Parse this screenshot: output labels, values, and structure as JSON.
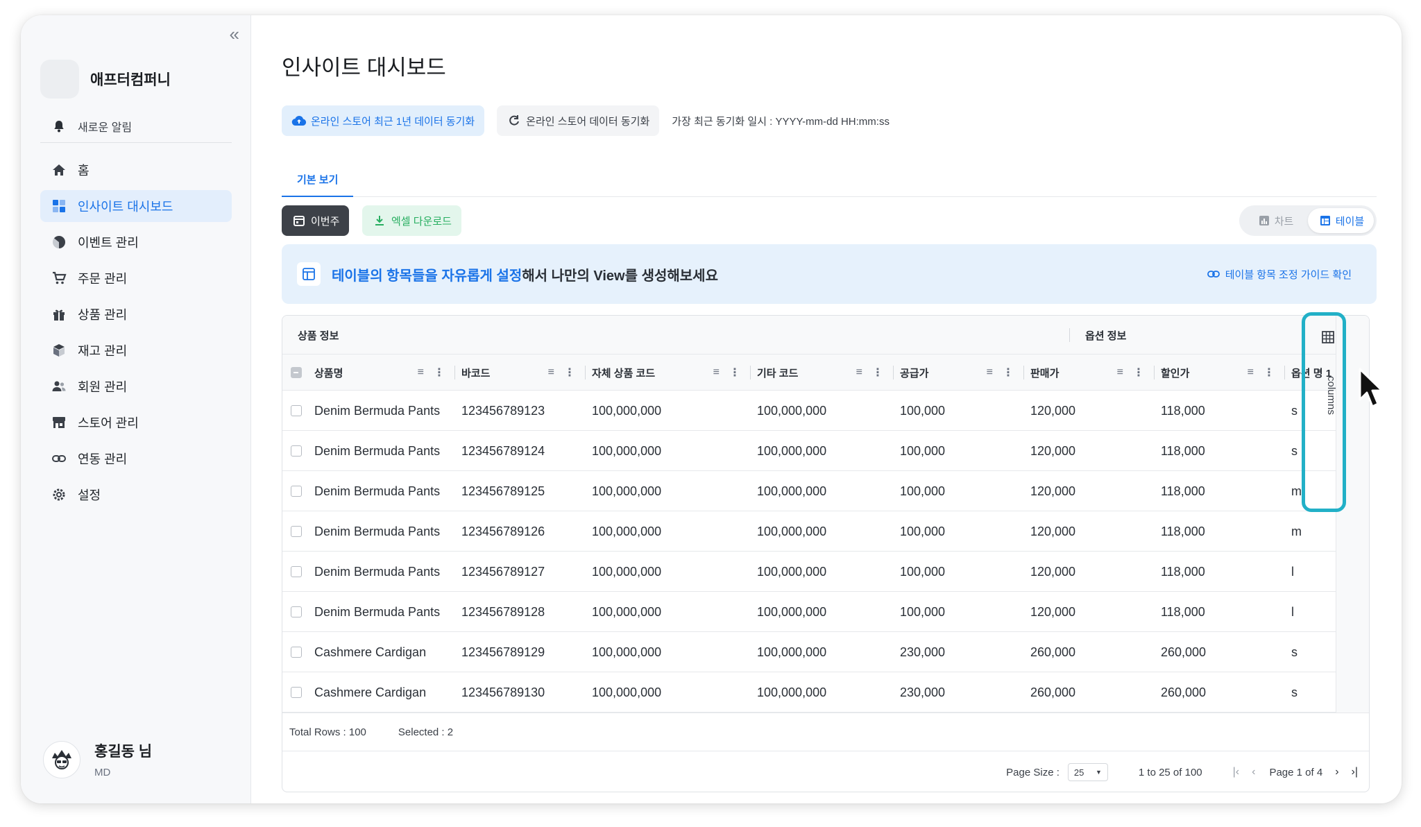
{
  "sidebar": {
    "company": "애프터컴퍼니",
    "notification": "새로운 알림",
    "items": [
      {
        "label": "홈",
        "icon": "home-icon"
      },
      {
        "label": "인사이트 대시보드",
        "icon": "dashboard-icon",
        "active": true
      },
      {
        "label": "이벤트 관리",
        "icon": "pie-chart-icon"
      },
      {
        "label": "주문 관리",
        "icon": "cart-icon"
      },
      {
        "label": "상품 관리",
        "icon": "gift-icon"
      },
      {
        "label": "재고 관리",
        "icon": "box-icon"
      },
      {
        "label": "회원 관리",
        "icon": "users-icon"
      },
      {
        "label": "스토어 관리",
        "icon": "store-icon"
      },
      {
        "label": "연동 관리",
        "icon": "link-icon"
      },
      {
        "label": "설정",
        "icon": "gear-icon"
      }
    ],
    "user": {
      "name": "홍길동 님",
      "role": "MD"
    }
  },
  "main": {
    "title": "인사이트 대시보드",
    "sync_1y": "온라인 스토어 최근 1년 데이터 동기화",
    "sync": "온라인 스토어 데이터 동기화",
    "last_sync": "가장 최근 동기화 일시 : YYYY-mm-dd HH:mm:ss",
    "tab": "기본 보기",
    "week_btn": "이번주",
    "excel_btn": "엑셀 다운로드",
    "toggle_chart": "차트",
    "toggle_table": "테이블",
    "banner_highlight": "테이블의 항목들을 자유롭게 설정",
    "banner_rest": "해서 나만의 View를 생성해보세요",
    "banner_link": "테이블 항목 조정 가이드 확인"
  },
  "grid": {
    "group_1": "상품 정보",
    "group_2": "옵션 정보",
    "columns": [
      "상품명",
      "바코드",
      "자체 상품 코드",
      "기타 코드",
      "공급가",
      "판매가",
      "할인가",
      "옵션 명 1"
    ],
    "rows": [
      [
        "Denim Bermuda Pants",
        "123456789123",
        "100,000,000",
        "100,000,000",
        "100,000",
        "120,000",
        "118,000",
        "s"
      ],
      [
        "Denim Bermuda Pants",
        "123456789124",
        "100,000,000",
        "100,000,000",
        "100,000",
        "120,000",
        "118,000",
        "s"
      ],
      [
        "Denim Bermuda Pants",
        "123456789125",
        "100,000,000",
        "100,000,000",
        "100,000",
        "120,000",
        "118,000",
        "m"
      ],
      [
        "Denim Bermuda Pants",
        "123456789126",
        "100,000,000",
        "100,000,000",
        "100,000",
        "120,000",
        "118,000",
        "m"
      ],
      [
        "Denim Bermuda Pants",
        "123456789127",
        "100,000,000",
        "100,000,000",
        "100,000",
        "120,000",
        "118,000",
        "l"
      ],
      [
        "Denim Bermuda Pants",
        "123456789128",
        "100,000,000",
        "100,000,000",
        "100,000",
        "120,000",
        "118,000",
        "l"
      ],
      [
        "Cashmere Cardigan",
        "123456789129",
        "100,000,000",
        "100,000,000",
        "230,000",
        "260,000",
        "260,000",
        "s"
      ],
      [
        "Cashmere Cardigan",
        "123456789130",
        "100,000,000",
        "100,000,000",
        "230,000",
        "260,000",
        "260,000",
        "s"
      ]
    ],
    "total_rows": "Total Rows : 100",
    "selected": "Selected : 2",
    "page_size_label": "Page Size :",
    "page_size": "25",
    "range": "1 to 25 of 100",
    "page_of": "Page 1 of 4",
    "columns_panel": "columns"
  },
  "colors": {
    "accent": "#1a73e8",
    "highlight": "#22b0c7",
    "excel": "#27ae60"
  }
}
